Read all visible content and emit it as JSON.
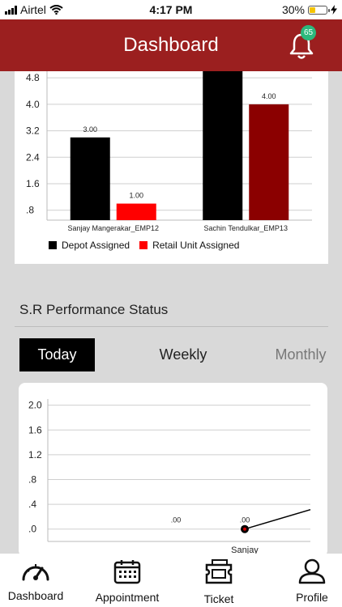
{
  "status_bar": {
    "carrier": "Airtel",
    "time": "4:17 PM",
    "battery": "30%"
  },
  "header": {
    "title": "Dashboard",
    "notification_count": "65"
  },
  "assignment_chart": {
    "legend": {
      "depot": "Depot Assigned",
      "retail": "Retail Unit Assigned"
    }
  },
  "performance": {
    "title": "S.R Performance Status",
    "tabs": {
      "today": "Today",
      "weekly": "Weekly",
      "monthly": "Monthly"
    }
  },
  "bottom_nav": {
    "dashboard": "Dashboard",
    "appointment": "Appointment",
    "ticket": "Ticket",
    "profile": "Profile"
  },
  "colors": {
    "header": "#9b1f1f",
    "depot": "#000000",
    "retail": "#8b0000",
    "retail_legend": "#ff0000",
    "badge": "#2db87c"
  },
  "chart_data": [
    {
      "type": "bar",
      "categories": [
        "Sanjay Mangerakar_EMP12",
        "Sachin Tendulkar_EMP13"
      ],
      "series": [
        {
          "name": "Depot Assigned",
          "values": [
            3.0,
            5.0
          ]
        },
        {
          "name": "Retail Unit Assigned",
          "values": [
            1.0,
            4.0
          ]
        }
      ],
      "data_labels": [
        [
          "3.00",
          "1.00"
        ],
        [
          null,
          "4.00"
        ]
      ],
      "yticks": [
        ".8",
        "1.6",
        "2.4",
        "3.2",
        "4.0",
        "4.8"
      ],
      "ylim": [
        0.5,
        5.0
      ],
      "grid": true,
      "legend": "bottom-left"
    },
    {
      "type": "line",
      "categories": [
        "",
        "Sanjay"
      ],
      "values": [
        0,
        0
      ],
      "data_labels": [
        ".00",
        ".00"
      ],
      "yticks": [
        ".0",
        ".4",
        ".8",
        "1.2",
        "1.6",
        "2.0"
      ],
      "ylim": [
        -0.2,
        2.1
      ],
      "grid": true
    }
  ]
}
